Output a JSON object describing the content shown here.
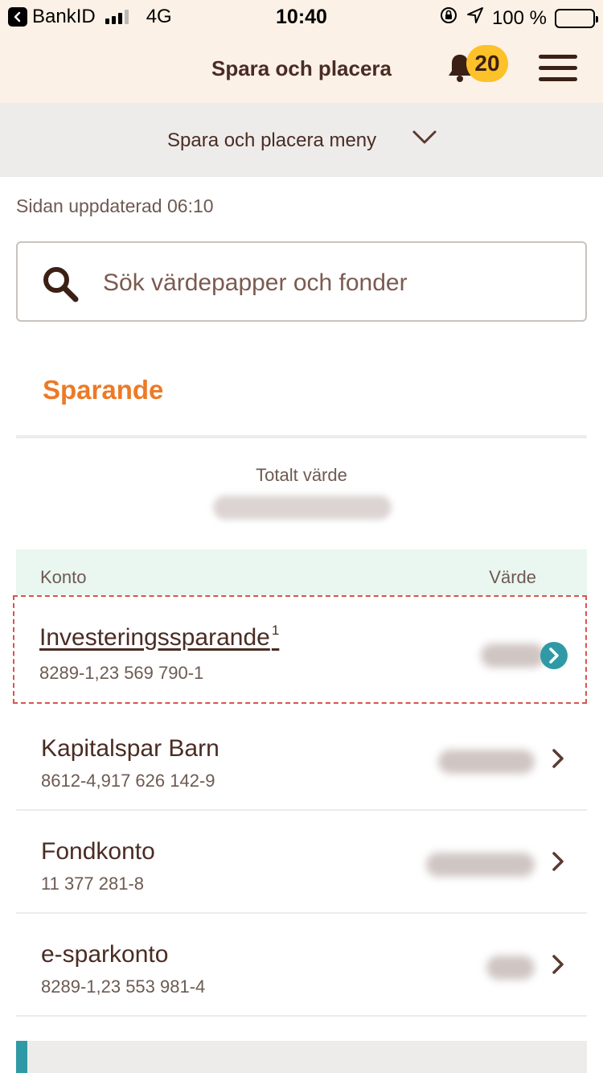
{
  "status_bar": {
    "back_app": "BankID",
    "network": "4G",
    "time": "10:40",
    "battery": "100 %"
  },
  "header": {
    "title": "Spara och placera",
    "notification_count": "20"
  },
  "submenu": {
    "label": "Spara och placera meny"
  },
  "updated_text": "Sidan uppdaterad 06:10",
  "search": {
    "placeholder": "Sök värdepapper och fonder"
  },
  "section": {
    "title": "Sparande",
    "total_label": "Totalt värde"
  },
  "table": {
    "col_account": "Konto",
    "col_value": "Värde",
    "rows": [
      {
        "name": "Investeringssparande",
        "footnote": "1",
        "number": "8289-1,23 569 790-1"
      },
      {
        "name": "Kapitalspar Barn",
        "number": "8612-4,917 626 142-9"
      },
      {
        "name": "Fondkonto",
        "number": "11 377 281-8"
      },
      {
        "name": "e-sparkonto",
        "number": "8289-1,23 553 981-4"
      }
    ]
  },
  "colors": {
    "accent_orange": "#ec7a26",
    "teal": "#2f9aa5",
    "badge_yellow": "#fdc129",
    "header_bg": "#fbf1e6",
    "text_brown": "#4a2c24"
  }
}
